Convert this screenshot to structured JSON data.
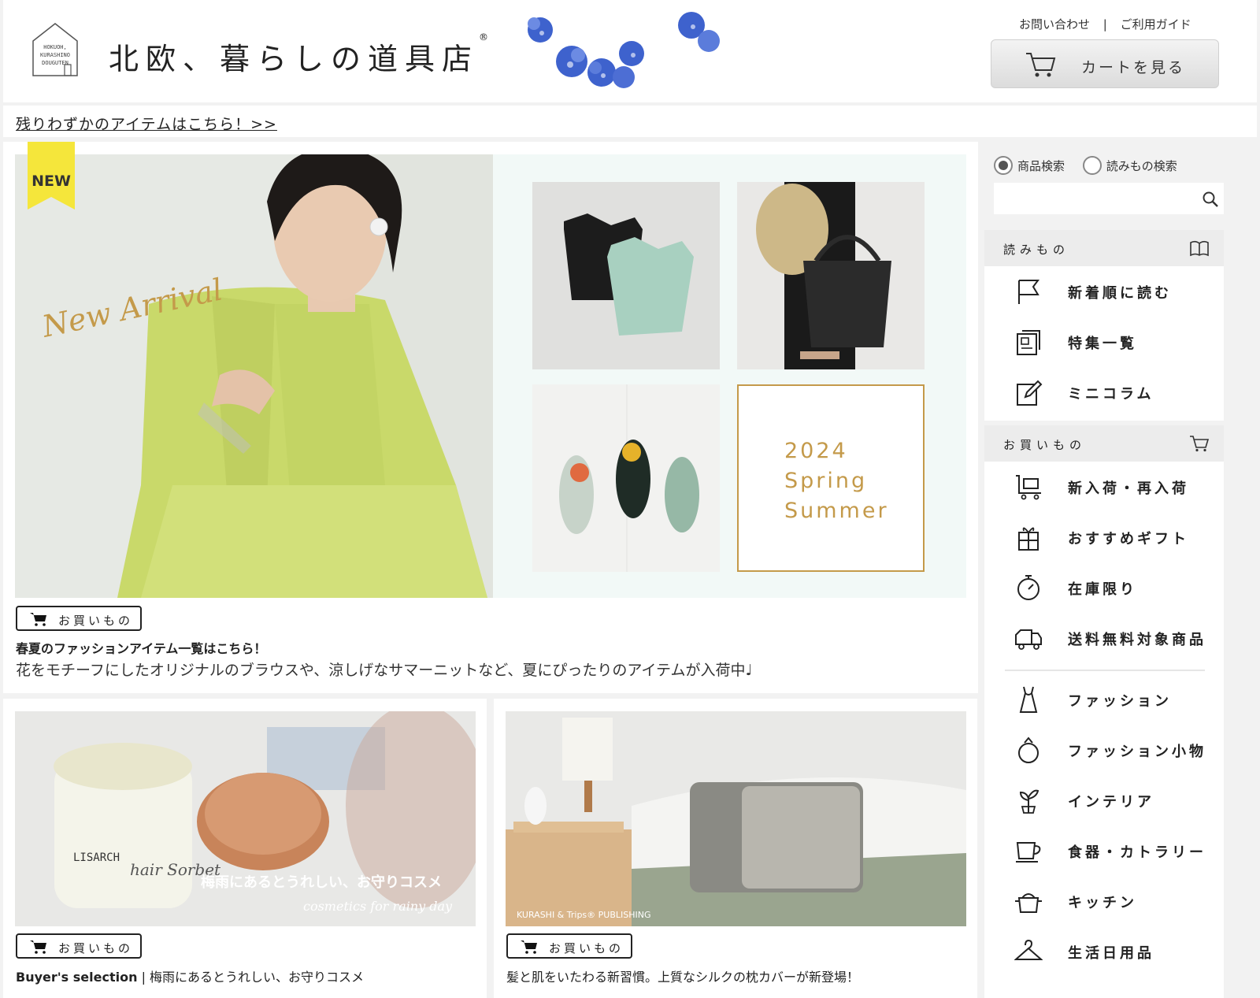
{
  "header": {
    "logo_lines": [
      "HOKUOH,",
      "KURASHINO",
      "DOUGUTEN"
    ],
    "brand": "北欧、暮らしの道具店",
    "brand_mark": "®",
    "contact_link": "お問い合わせ",
    "separator": "|",
    "guide_link": "ご利用ガイド",
    "cart_button": "カートを見る"
  },
  "notice": {
    "link": "残りわずかのアイテムはこちら！>>"
  },
  "hero": {
    "badge": "NEW",
    "script_text": "New Arrival",
    "season": [
      "2024",
      "Spring",
      "Summer"
    ],
    "tag": "お買いもの",
    "title": "春夏のファッションアイテム一覧はこちら！",
    "desc": "花をモチーフにしたオリジナルのブラウスや、涼しげなサマーニットなど、夏にぴったりのアイテムが入荷中♩"
  },
  "card_left": {
    "overlay_jp": "梅雨にあるとうれしい、お守りコスメ",
    "overlay_en": "cosmetics for rainy day",
    "jar_text": "LISARCH",
    "jar_script": "hair Sorbet",
    "tag": "お買いもの",
    "title_bold": "Buyer's selection",
    "title_sep": "|",
    "title_rest": "梅雨にあるとうれしい、お守りコスメ"
  },
  "card_right": {
    "credit": "KURASHI & Trips® PUBLISHING",
    "tag": "お買いもの",
    "title": "髪と肌をいたわる新習慣。上質なシルクの枕カバーが新登場！"
  },
  "sidebar": {
    "radio_products": "商品検索",
    "radio_reading": "読みもの検索",
    "search_placeholder": "",
    "reading_header": "読みもの",
    "reading_items": [
      {
        "label": "新着順に読む",
        "icon": "flag-icon"
      },
      {
        "label": "特集一覧",
        "icon": "newspaper-icon"
      },
      {
        "label": "ミニコラム",
        "icon": "edit-icon"
      }
    ],
    "shopping_header": "お買いもの",
    "shopping_items": [
      {
        "label": "新入荷・再入荷",
        "icon": "cart-box-icon"
      },
      {
        "label": "おすすめギフト",
        "icon": "gift-icon"
      },
      {
        "label": "在庫限り",
        "icon": "stopwatch-icon"
      },
      {
        "label": "送料無料対象商品",
        "icon": "truck-icon"
      },
      {
        "label": "ファッション",
        "icon": "dress-icon"
      },
      {
        "label": "ファッション小物",
        "icon": "ring-icon"
      },
      {
        "label": "インテリア",
        "icon": "plant-icon"
      },
      {
        "label": "食器・カトラリー",
        "icon": "cup-icon"
      },
      {
        "label": "キッチン",
        "icon": "pot-icon"
      },
      {
        "label": "生活日用品",
        "icon": "hanger-icon"
      }
    ]
  }
}
